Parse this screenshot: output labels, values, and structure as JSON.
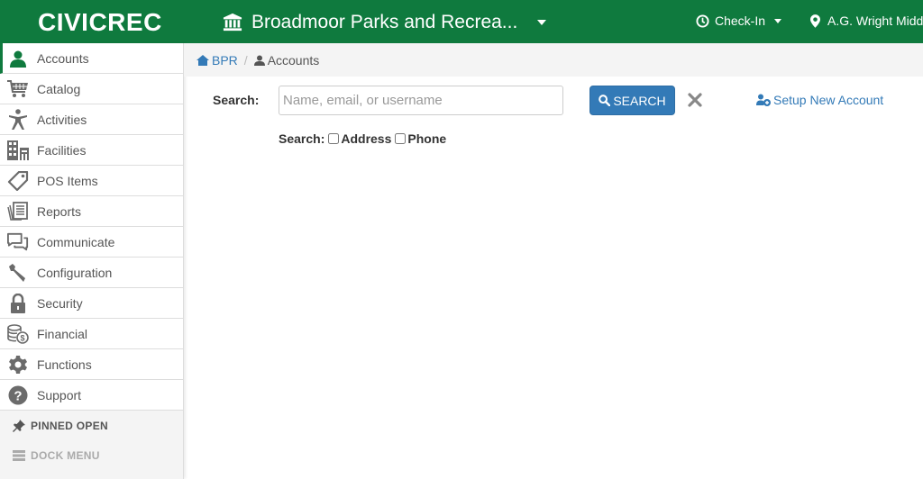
{
  "topbar": {
    "logo": "CIVICREC",
    "organization": "Broadmoor Parks and Recrea...",
    "checkin_label": "Check-In",
    "location_label": "A.G. Wright Middl"
  },
  "sidebar": {
    "items": [
      {
        "label": "Accounts",
        "icon": "user-icon",
        "active": true
      },
      {
        "label": "Catalog",
        "icon": "cart-icon"
      },
      {
        "label": "Activities",
        "icon": "person-icon"
      },
      {
        "label": "Facilities",
        "icon": "building-icon"
      },
      {
        "label": "POS Items",
        "icon": "tag-icon"
      },
      {
        "label": "Reports",
        "icon": "reports-icon"
      },
      {
        "label": "Communicate",
        "icon": "chat-icon"
      },
      {
        "label": "Configuration",
        "icon": "wrench-icon"
      },
      {
        "label": "Security",
        "icon": "lock-icon"
      },
      {
        "label": "Financial",
        "icon": "coins-icon"
      },
      {
        "label": "Functions",
        "icon": "gear-icon"
      },
      {
        "label": "Support",
        "icon": "question-icon"
      }
    ],
    "pinned_label": "PINNED OPEN",
    "dock_label": "DOCK MENU"
  },
  "breadcrumb": {
    "root": "BPR",
    "separator": "/",
    "current": "Accounts"
  },
  "search": {
    "label": "Search:",
    "placeholder": "Name, email, or username",
    "value": "",
    "button_label": "SEARCH",
    "options_label": "Search:",
    "options": [
      {
        "label": "Address",
        "checked": false
      },
      {
        "label": "Phone",
        "checked": false
      }
    ],
    "setup_link": "Setup New Account"
  },
  "colors": {
    "brand_green": "#0f7a3e",
    "primary_blue": "#337ab7",
    "icon_gray": "#6b6b6b"
  }
}
